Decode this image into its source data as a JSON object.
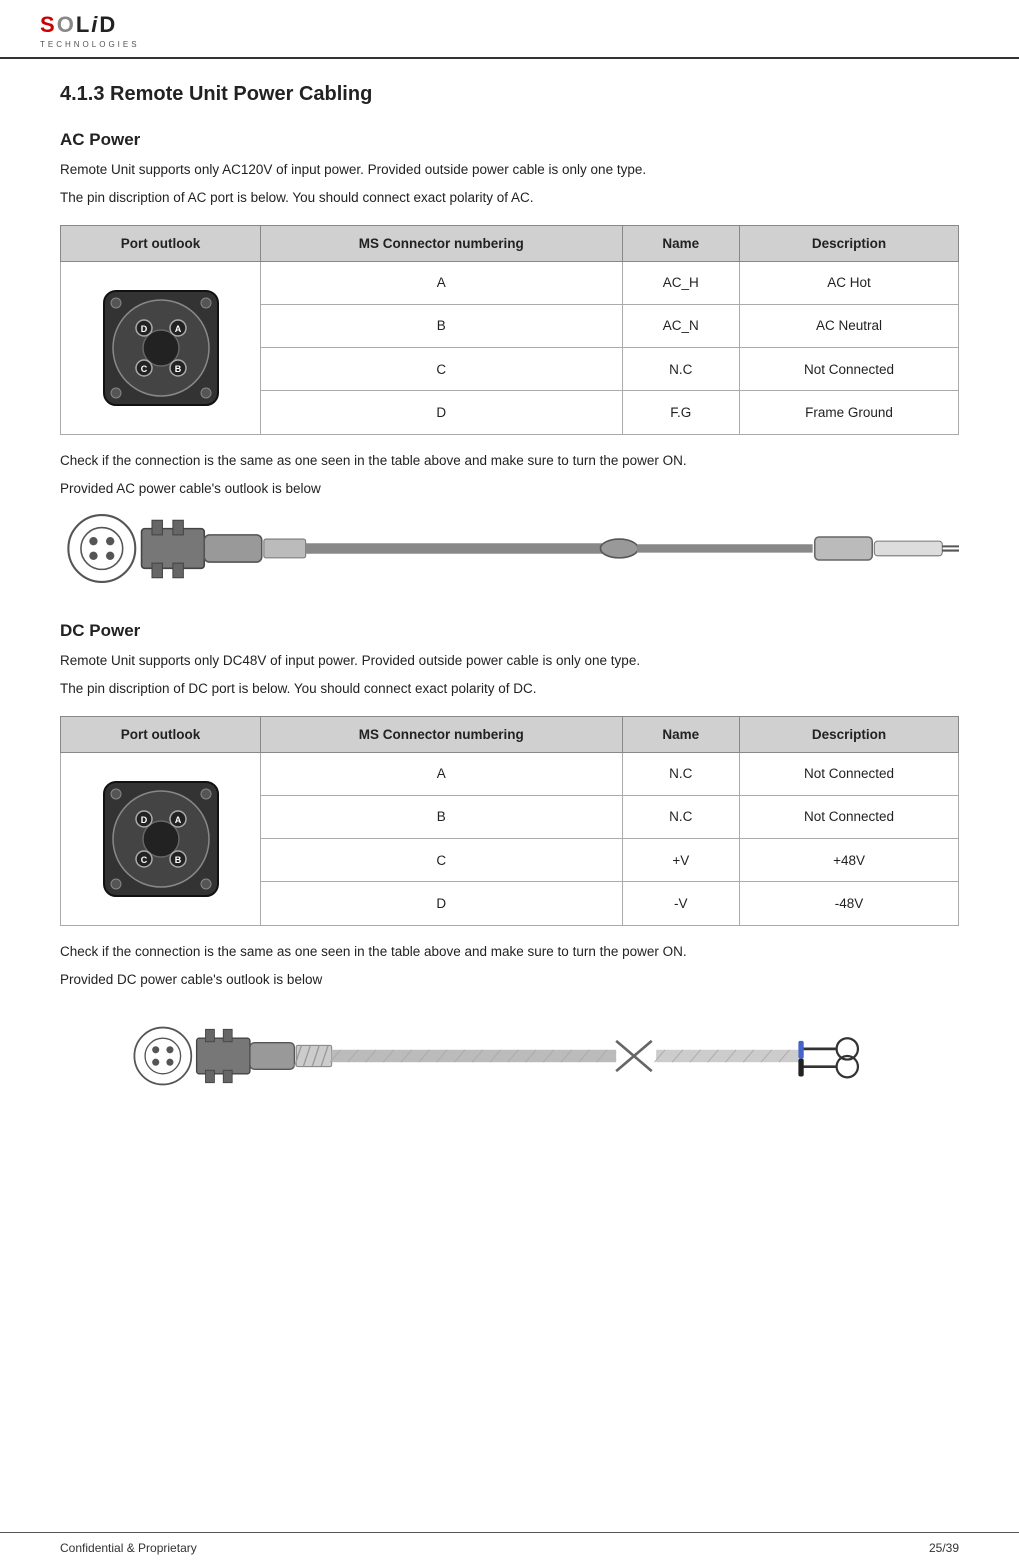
{
  "header": {
    "logo_letters": "SOLiD",
    "logo_sub": "TECHNOLOGIES"
  },
  "section": {
    "title": "4.1.3 Remote Unit Power Cabling"
  },
  "ac_section": {
    "title": "AC Power",
    "para1": "Remote Unit supports only AC120V of input power. Provided outside power cable is only one type.",
    "para2": "The pin discription of AC port is below. You should connect exact polarity of AC.",
    "table_headers": [
      "Port outlook",
      "MS Connector numbering",
      "Name",
      "Description"
    ],
    "table_rows": [
      {
        "ms": "A",
        "name": "AC_H",
        "desc": "AC Hot"
      },
      {
        "ms": "B",
        "name": "AC_N",
        "desc": "AC Neutral"
      },
      {
        "ms": "C",
        "name": "N.C",
        "desc": "Not Connected"
      },
      {
        "ms": "D",
        "name": "F.G",
        "desc": "Frame Ground"
      }
    ],
    "check_text1": "Check if the connection is the same as one seen in the table above and make sure to turn the power ON.",
    "check_text2": "Provided AC power cable's outlook is below"
  },
  "dc_section": {
    "title": "DC Power",
    "para1": "Remote Unit supports only DC48V of input power. Provided outside power cable is only one type.",
    "para2": "The pin discription of DC port is below. You should connect exact polarity of DC.",
    "table_headers": [
      "Port outlook",
      "MS Connector numbering",
      "Name",
      "Description"
    ],
    "table_rows": [
      {
        "ms": "A",
        "name": "N.C",
        "desc": "Not Connected"
      },
      {
        "ms": "B",
        "name": "N.C",
        "desc": "Not Connected"
      },
      {
        "ms": "C",
        "name": "+V",
        "desc": "+48V"
      },
      {
        "ms": "D",
        "name": "-V",
        "desc": "-48V"
      }
    ],
    "check_text1": "Check if the connection is the same as one seen in the table above and make sure to turn the power ON.",
    "check_text2": "Provided DC power cable's outlook is below"
  },
  "footer": {
    "left": "Confidential & Proprietary",
    "right": "25/39"
  }
}
